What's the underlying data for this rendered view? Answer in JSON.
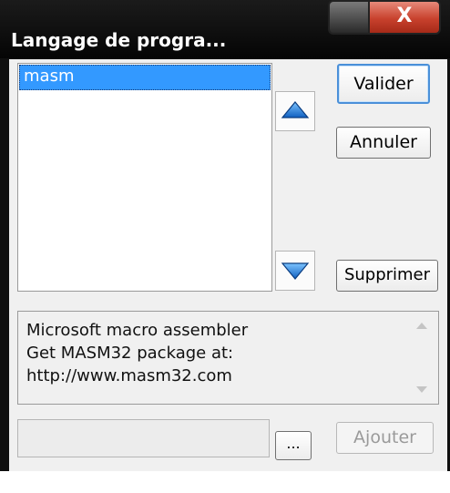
{
  "window": {
    "title": "Langage de progra...",
    "close_label": "X"
  },
  "list": {
    "items": [
      "masm"
    ],
    "selected_index": 0
  },
  "buttons": {
    "valider": "Valider",
    "annuler": "Annuler",
    "supprimer": "Supprimer",
    "ajouter": "Ajouter",
    "browse": "..."
  },
  "description": {
    "lines": [
      "Microsoft macro assembler",
      "Get MASM32 package at:",
      "http://www.masm32.com"
    ]
  },
  "path_field": {
    "value": ""
  },
  "icons": {
    "move_up": "arrow-up-icon",
    "move_down": "arrow-down-icon",
    "close": "close-icon",
    "minimize": "minimize-icon"
  },
  "colors": {
    "selection": "#3399ff",
    "arrow_blue": "#1e7fd8",
    "close_red": "#c8412d"
  }
}
